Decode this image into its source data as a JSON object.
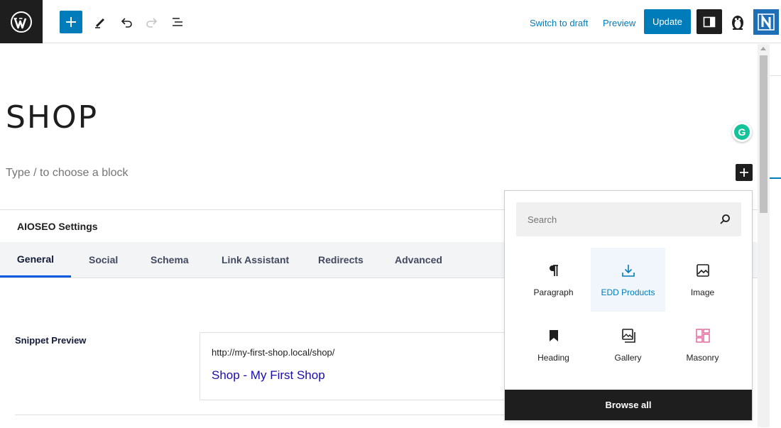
{
  "toolbar": {
    "switch_to_draft": "Switch to draft",
    "preview": "Preview",
    "update": "Update"
  },
  "editor": {
    "title": "SHOP",
    "placeholder": "Type / to choose a block"
  },
  "aioseo": {
    "title": "AIOSEO Settings",
    "tabs": [
      {
        "label": "General",
        "active": true
      },
      {
        "label": "Social"
      },
      {
        "label": "Schema"
      },
      {
        "label": "Link Assistant"
      },
      {
        "label": "Redirects"
      },
      {
        "label": "Advanced"
      }
    ],
    "snippet_label": "Snippet Preview",
    "snippet_url": "http://my-first-shop.local/shop/",
    "snippet_title": "Shop - My First Shop"
  },
  "inserter": {
    "search_placeholder": "Search",
    "blocks": [
      {
        "label": "Paragraph",
        "icon": "paragraph-icon"
      },
      {
        "label": "EDD Products",
        "icon": "download-icon",
        "highlighted": true
      },
      {
        "label": "Image",
        "icon": "image-icon"
      },
      {
        "label": "Heading",
        "icon": "bookmark-icon"
      },
      {
        "label": "Gallery",
        "icon": "gallery-icon"
      },
      {
        "label": "Masonry",
        "icon": "masonry-icon"
      }
    ],
    "browse_all": "Browse all"
  },
  "colors": {
    "accent": "#007cba",
    "dark": "#1e1e1e",
    "masonry_icon": "#e0609a",
    "snippet_title": "#1a0dab"
  }
}
